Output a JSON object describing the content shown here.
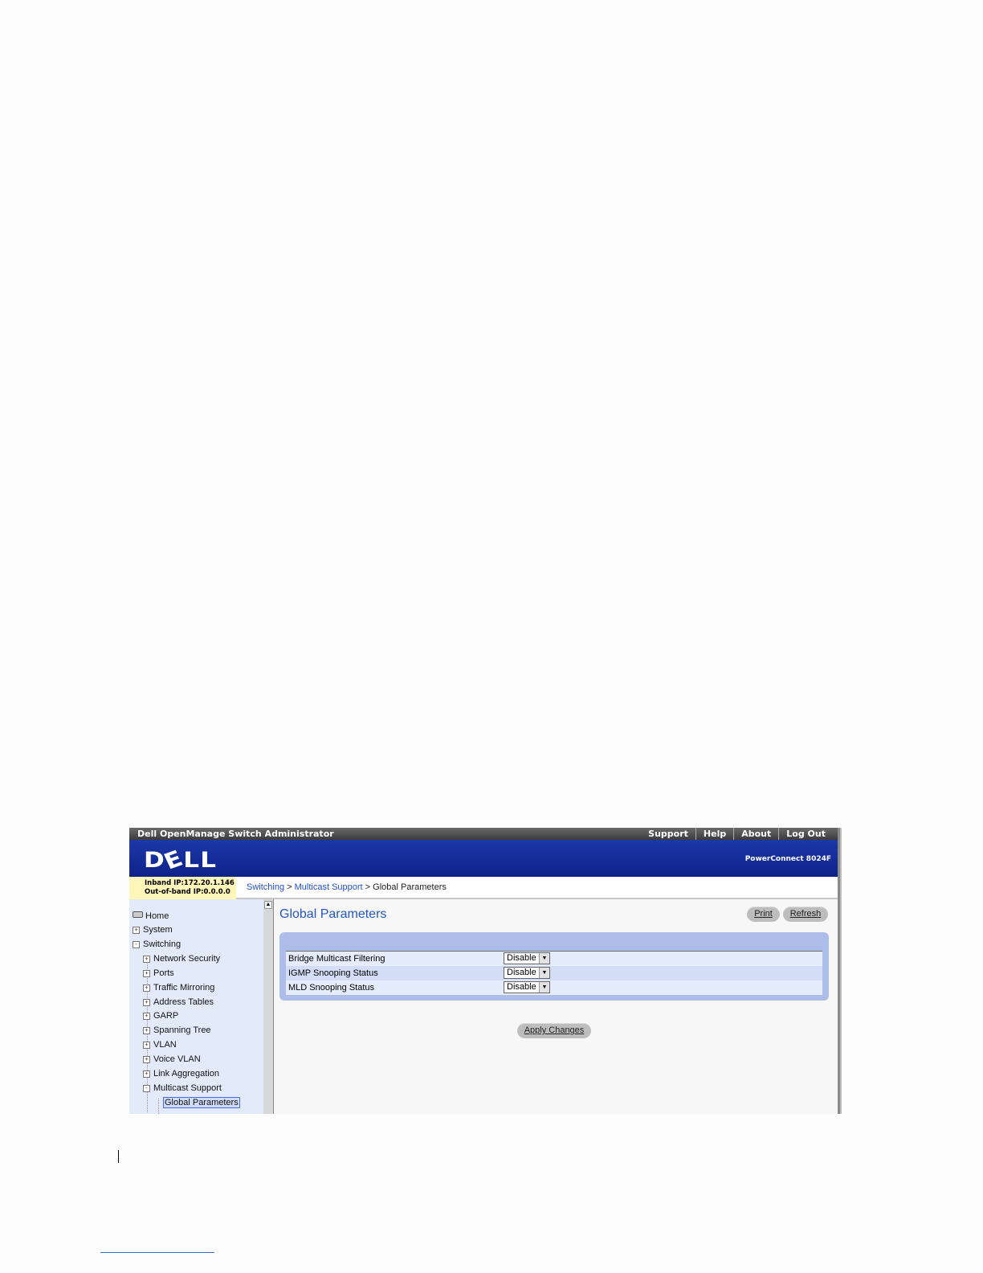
{
  "titlebar": {
    "app_title": "Dell OpenManage Switch Administrator",
    "links": [
      "Support",
      "Help",
      "About",
      "Log Out"
    ]
  },
  "banner": {
    "logo_text": "DELL",
    "product": "PowerConnect 8024F"
  },
  "ip": {
    "inband": "Inband IP:172.20.1.146",
    "outofband": "Out-of-band IP:0.0.0.0"
  },
  "breadcrumb": {
    "item1": "Switching",
    "sep1": " > ",
    "item2": "Multicast Support",
    "sep2": " > ",
    "current": "Global Parameters"
  },
  "nav": {
    "home": "Home",
    "system": "System",
    "switching": "Switching",
    "children": [
      "Network Security",
      "Ports",
      "Traffic Mirroring",
      "Address Tables",
      "GARP",
      "Spanning Tree",
      "VLAN",
      "Voice VLAN",
      "Link Aggregation",
      "Multicast Support"
    ],
    "selected": "Global Parameters"
  },
  "page": {
    "title": "Global Parameters",
    "print_label": "Print",
    "refresh_label": "Refresh",
    "apply_label": "Apply Changes"
  },
  "params": [
    {
      "label": "Bridge Multicast Filtering",
      "value": "Disable"
    },
    {
      "label": "IGMP Snooping Status",
      "value": "Disable"
    },
    {
      "label": "MLD Snooping Status",
      "value": "Disable"
    }
  ],
  "colors": {
    "banner": "#1c38a8",
    "ipbox": "#fdf6b8",
    "panel": "#aebde8",
    "link": "#1f4fcf"
  }
}
